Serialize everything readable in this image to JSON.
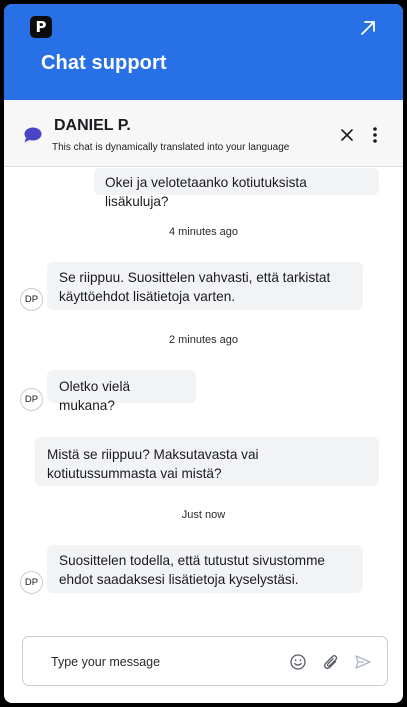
{
  "header": {
    "logo_letter": "P",
    "title": "Chat support",
    "expand_icon": "arrow-up-right-icon",
    "background_color": "#2770e6"
  },
  "agent": {
    "name": "DANIEL P.",
    "subtitle": "This chat is dynamically translated into your language",
    "icon": "chat-bubble-icon",
    "close_icon": "close-icon",
    "more_icon": "more-vertical-icon"
  },
  "messages": [
    {
      "sender": "user",
      "text": "Okei ja velotetaanko kotiutuksista lisäkuluja?"
    },
    {
      "type": "timestamp",
      "text": "4 minutes ago"
    },
    {
      "sender": "agent",
      "avatar": "DP",
      "text": "Se riippuu. Suosittelen vahvasti, että tarkistat käyttöehdot lisätietoja varten."
    },
    {
      "type": "timestamp",
      "text": "2 minutes ago"
    },
    {
      "sender": "agent",
      "avatar": "DP",
      "text": "Oletko vielä mukana?"
    },
    {
      "sender": "user",
      "text": "Mistä se riippuu? Maksutavasta vai kotiutussummasta vai mistä?"
    },
    {
      "type": "timestamp",
      "text": "Just now"
    },
    {
      "sender": "agent",
      "avatar": "DP",
      "text": "Suosittelen todella, että tutustut sivustomme ehdot saadaksesi lisätietoja kyselystäsi."
    }
  ],
  "composer": {
    "placeholder": "Type your message",
    "value": "",
    "emoji_icon": "emoji-smile-icon",
    "attach_icon": "paperclip-icon",
    "send_icon": "send-icon"
  }
}
